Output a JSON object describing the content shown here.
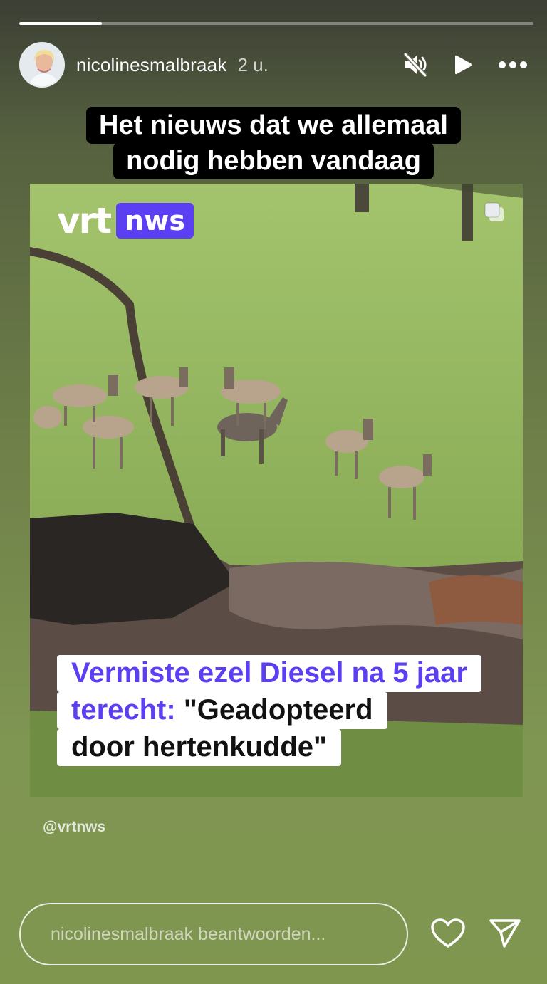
{
  "story": {
    "progress": 0.16,
    "username": "nicolinesmalbraak",
    "time": "2 u."
  },
  "header_icons": [
    "volume-muted-icon",
    "play-icon",
    "more-icon"
  ],
  "caption": {
    "line1": "Het nieuws dat we allemaal",
    "line2": "nodig hebben vandaag"
  },
  "video": {
    "logo_left": "vrt",
    "logo_right": "nws",
    "headline_purple_1": "Vermiste ezel Diesel na 5 jaar",
    "headline_purple_2": "terecht:",
    "headline_black_2": " \"Geadopteerd",
    "headline_black_3": "door hertenkudde\"",
    "brand_color": "#5b3ff2"
  },
  "credit": "@vrtnws",
  "reply": {
    "placeholder": "nicolinesmalbraak beantwoorden..."
  }
}
